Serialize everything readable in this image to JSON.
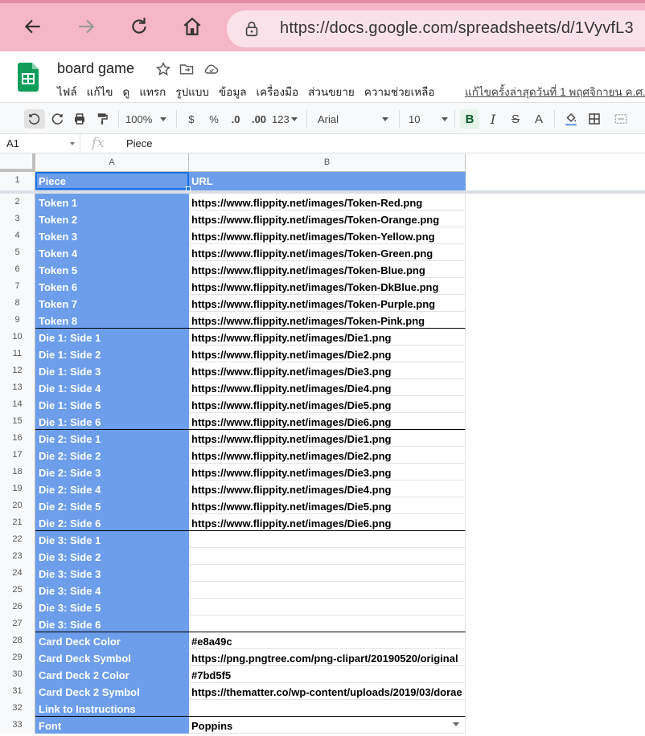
{
  "browser": {
    "url": "https://docs.google.com/spreadsheets/d/1VyvfL3",
    "icons": [
      "back-arrow-icon",
      "forward-arrow-icon",
      "reload-icon",
      "home-icon",
      "lock-icon"
    ]
  },
  "app": {
    "title": "board game",
    "menu": [
      "ไฟล์",
      "แก้ไข",
      "ดู",
      "แทรก",
      "รูปแบบ",
      "ข้อมูล",
      "เครื่องมือ",
      "ส่วนขยาย",
      "ความช่วยเหลือ"
    ],
    "last_edit": "แก้ไขครั้งล่าสุดวันที่ 1 พฤศจิกายน ค.ศ."
  },
  "toolbar": {
    "zoom": "100%",
    "currency": "$",
    "percent": "%",
    "dec_decrease": ".0",
    "dec_increase": ".00",
    "more_formats": "123",
    "font": "Arial",
    "font_size": "10",
    "bold": "B",
    "italic": "I",
    "strike": "S",
    "text_color": "A"
  },
  "formula_bar": {
    "cell_ref": "A1",
    "fx": "fx",
    "value": "Piece"
  },
  "columns": [
    "A",
    "B"
  ],
  "rows": [
    {
      "n": "1",
      "a": "Piece",
      "b": "URL"
    },
    {
      "n": "2",
      "a": "Token 1",
      "b": "https://www.flippity.net/images/Token-Red.png"
    },
    {
      "n": "3",
      "a": "Token 2",
      "b": "https://www.flippity.net/images/Token-Orange.png"
    },
    {
      "n": "4",
      "a": "Token 3",
      "b": "https://www.flippity.net/images/Token-Yellow.png"
    },
    {
      "n": "5",
      "a": "Token 4",
      "b": "https://www.flippity.net/images/Token-Green.png"
    },
    {
      "n": "6",
      "a": "Token 5",
      "b": "https://www.flippity.net/images/Token-Blue.png"
    },
    {
      "n": "7",
      "a": "Token 6",
      "b": "https://www.flippity.net/images/Token-DkBlue.png"
    },
    {
      "n": "8",
      "a": "Token 7",
      "b": "https://www.flippity.net/images/Token-Purple.png"
    },
    {
      "n": "9",
      "a": "Token 8",
      "b": "https://www.flippity.net/images/Token-Pink.png"
    },
    {
      "n": "10",
      "a": "Die 1: Side 1",
      "b": "https://www.flippity.net/images/Die1.png"
    },
    {
      "n": "11",
      "a": "Die 1: Side 2",
      "b": "https://www.flippity.net/images/Die2.png"
    },
    {
      "n": "12",
      "a": "Die 1: Side 3",
      "b": "https://www.flippity.net/images/Die3.png"
    },
    {
      "n": "13",
      "a": "Die 1: Side 4",
      "b": "https://www.flippity.net/images/Die4.png"
    },
    {
      "n": "14",
      "a": "Die 1: Side 5",
      "b": "https://www.flippity.net/images/Die5.png"
    },
    {
      "n": "15",
      "a": "Die 1: Side 6",
      "b": "https://www.flippity.net/images/Die6.png"
    },
    {
      "n": "16",
      "a": "Die 2: Side 1",
      "b": "https://www.flippity.net/images/Die1.png"
    },
    {
      "n": "17",
      "a": "Die 2: Side 2",
      "b": "https://www.flippity.net/images/Die2.png"
    },
    {
      "n": "18",
      "a": "Die 2: Side 3",
      "b": "https://www.flippity.net/images/Die3.png"
    },
    {
      "n": "19",
      "a": "Die 2: Side 4",
      "b": "https://www.flippity.net/images/Die4.png"
    },
    {
      "n": "20",
      "a": "Die 2: Side 5",
      "b": "https://www.flippity.net/images/Die5.png"
    },
    {
      "n": "21",
      "a": "Die 2: Side 6",
      "b": "https://www.flippity.net/images/Die6.png"
    },
    {
      "n": "22",
      "a": "Die 3: Side 1",
      "b": ""
    },
    {
      "n": "23",
      "a": "Die 3: Side 2",
      "b": ""
    },
    {
      "n": "24",
      "a": "Die 3: Side 3",
      "b": ""
    },
    {
      "n": "25",
      "a": "Die 3: Side 4",
      "b": ""
    },
    {
      "n": "26",
      "a": "Die 3: Side 5",
      "b": ""
    },
    {
      "n": "27",
      "a": "Die 3: Side 6",
      "b": ""
    },
    {
      "n": "28",
      "a": "Card Deck Color",
      "b": "#e8a49c"
    },
    {
      "n": "29",
      "a": "Card Deck Symbol",
      "b": "https://png.pngtree.com/png-clipart/20190520/original"
    },
    {
      "n": "30",
      "a": "Card Deck 2 Color",
      "b": "#7bd5f5"
    },
    {
      "n": "31",
      "a": "Card Deck 2 Symbol",
      "b": "https://thematter.co/wp-content/uploads/2019/03/dorae"
    },
    {
      "n": "32",
      "a": "Link to Instructions",
      "b": ""
    },
    {
      "n": "33",
      "a": "Font",
      "b": "Poppins"
    }
  ],
  "colors": {
    "header_fill": "#6d9eeb",
    "selection": "#1a73e8",
    "browser_bar": "#f5b6c8",
    "sheets_green": "#0f9d58"
  }
}
